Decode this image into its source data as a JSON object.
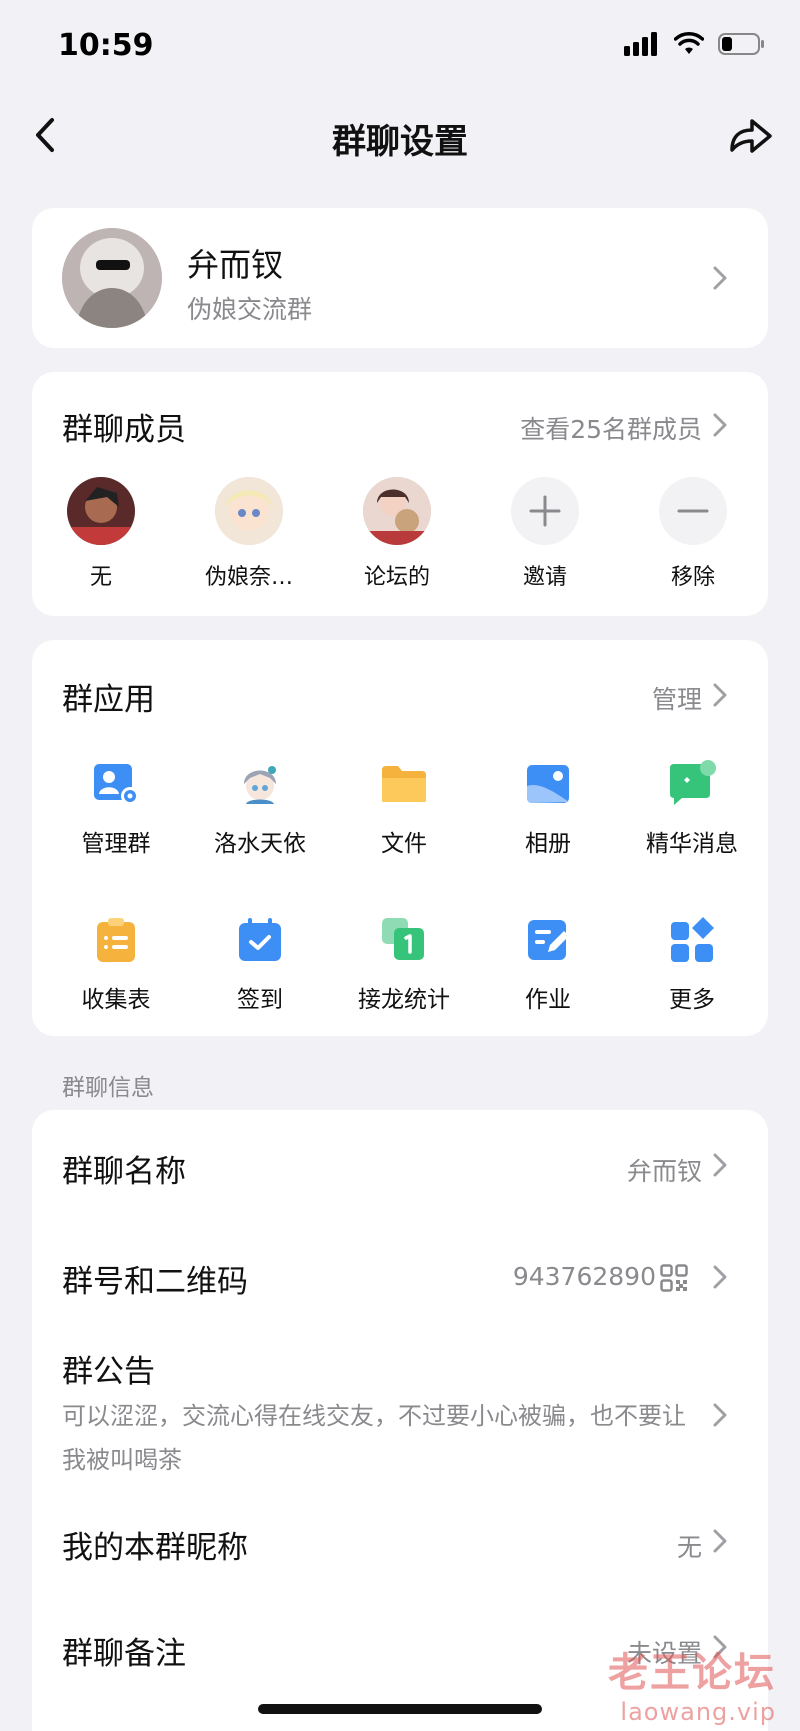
{
  "status": {
    "time": "10:59"
  },
  "nav": {
    "title": "群聊设置"
  },
  "group": {
    "name": "弁而钗",
    "subtitle": "伪娘交流群"
  },
  "members": {
    "title": "群聊成员",
    "view_all": "查看25名群成员",
    "list": [
      {
        "label": "无"
      },
      {
        "label": "伪娘奈…"
      },
      {
        "label": "论坛的"
      },
      {
        "label": "邀请",
        "icon": "plus-icon"
      },
      {
        "label": "移除",
        "icon": "minus-icon"
      }
    ]
  },
  "apps": {
    "title": "群应用",
    "manage": "管理",
    "items": [
      {
        "label": "管理群",
        "icon": "group-manage-icon"
      },
      {
        "label": "洛水天依",
        "icon": "luotianyi-avatar-icon"
      },
      {
        "label": "文件",
        "icon": "folder-icon"
      },
      {
        "label": "相册",
        "icon": "album-icon"
      },
      {
        "label": "精华消息",
        "icon": "essence-message-icon"
      },
      {
        "label": "收集表",
        "icon": "clipboard-icon"
      },
      {
        "label": "签到",
        "icon": "calendar-check-icon"
      },
      {
        "label": "接龙统计",
        "icon": "relay-count-icon"
      },
      {
        "label": "作业",
        "icon": "homework-edit-icon"
      },
      {
        "label": "更多",
        "icon": "more-apps-icon"
      }
    ]
  },
  "info": {
    "section_label": "群聊信息",
    "group_name_label": "群聊名称",
    "group_name_value": "弁而钗",
    "group_id_label": "群号和二维码",
    "group_id_value": "943762890",
    "notice_label": "群公告",
    "notice_text": "可以涩涩，交流心得在线交友，不过要小心被骗，也不要让我被叫喝茶",
    "nickname_label": "我的本群昵称",
    "nickname_value": "无",
    "remark_label": "群聊备注",
    "remark_value": "未设置"
  },
  "watermark": {
    "title": "老王论坛",
    "url": "laowang.vip"
  },
  "colors": {
    "background": "#f2f2f6",
    "card": "#ffffff",
    "secondary_text": "#8a8a8e",
    "blue": "#3d8ff5",
    "orange": "#f5b23d",
    "green": "#35c47a"
  }
}
